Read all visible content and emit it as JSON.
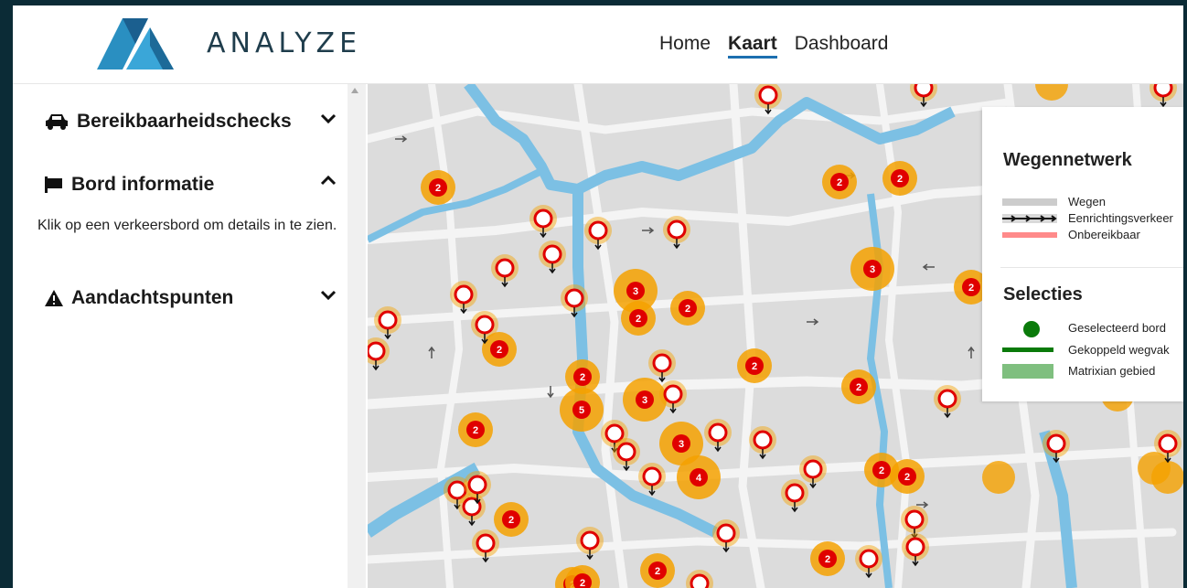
{
  "header": {
    "brand": "ANALYZE",
    "nav": [
      {
        "label": "Home",
        "active": false
      },
      {
        "label": "Kaart",
        "active": true
      },
      {
        "label": "Dashboard",
        "active": false
      }
    ]
  },
  "sidebar": {
    "sections": [
      {
        "icon": "car-icon",
        "title": "Bereikbaarheidschecks",
        "expanded": false
      },
      {
        "icon": "signpost-icon",
        "title": "Bord informatie",
        "expanded": true,
        "body": "Klik op een verkeersbord om details in te zien."
      },
      {
        "icon": "warning-icon",
        "title": "Aandachtspunten",
        "expanded": false
      }
    ]
  },
  "legend": {
    "network_title": "Wegennetwerk",
    "network_items": [
      {
        "label": "Wegen",
        "color": "#cccccc"
      },
      {
        "label": "Eenrichtingsverkeer",
        "color": "#111111"
      },
      {
        "label": "Onbereikbaar",
        "color": "#ff8a8a"
      }
    ],
    "selection_title": "Selecties",
    "selection_items": [
      {
        "label": "Geselecteerd bord",
        "color": "#0a7a0a"
      },
      {
        "label": "Gekoppeld wegvak",
        "color": "#0a7a0a"
      },
      {
        "label": "Matrixian gebied",
        "color": "#7fbf7f"
      }
    ]
  },
  "map": {
    "colors": {
      "canal": "#7cc0e4",
      "road": "#f2f2f2",
      "block": "#d8d8d8",
      "cluster": "#f5a100",
      "cluster_badge": "#e00000",
      "sign_ring": "#e00000"
    },
    "clusters": [
      "2",
      "2",
      "2",
      "3",
      "3",
      "2",
      "2",
      "2",
      "2",
      "2",
      "5",
      "3",
      "2",
      "2",
      "2",
      "3",
      "4",
      "2",
      "2",
      "2",
      "2",
      "2",
      "2",
      "2"
    ]
  }
}
